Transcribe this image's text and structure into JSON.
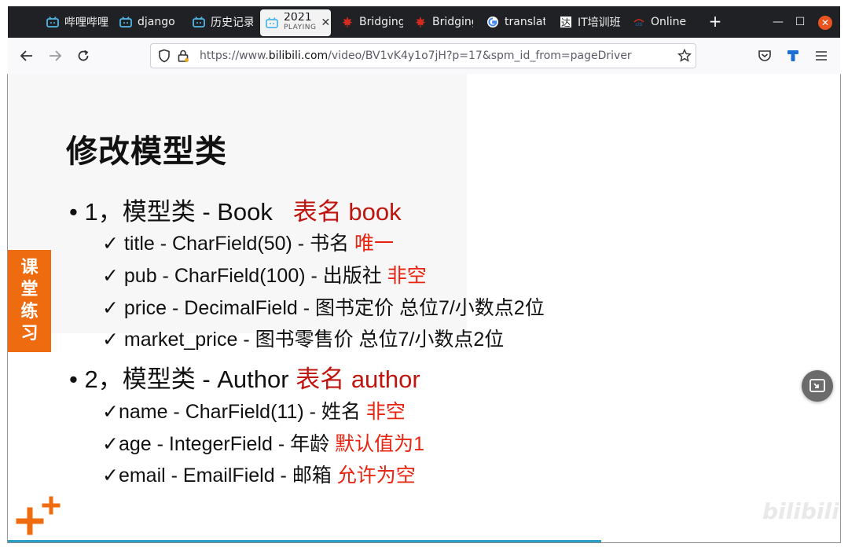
{
  "tabs": [
    {
      "label": "哔哩哔哩",
      "icon": "bilibili-icon"
    },
    {
      "label": "django",
      "icon": "bilibili-icon"
    },
    {
      "label": "历史记录",
      "icon": "bilibili-icon"
    },
    {
      "label": "2021",
      "sub": "PLAYING",
      "icon": "bilibili-icon",
      "active": true
    },
    {
      "label": "Bridging",
      "icon": "maple-leaf-icon"
    },
    {
      "label": "Bridging",
      "icon": "maple-leaf-icon"
    },
    {
      "label": "translat",
      "icon": "google-icon"
    },
    {
      "label": "IT培训班",
      "icon": "da-icon"
    },
    {
      "label": "Online",
      "icon": "citi-icon"
    }
  ],
  "url": {
    "prefix": "https://www.",
    "domain": "bilibili.com",
    "path": "/video/BV1vK4y1o7jH?p=17&spm_id_from=pageDriver"
  },
  "slide": {
    "title": "修改模型类",
    "side_tab": [
      "课",
      "堂",
      "练",
      "习"
    ],
    "item1": {
      "lead": "• 1，模型类 - Book",
      "red": "表名 book"
    },
    "item1_fields": [
      {
        "text": "✓  title - CharField(50)  - 书名 ",
        "red": "唯一"
      },
      {
        "text": "✓  pub - CharField(100)  - 出版社 ",
        "red": "非空"
      },
      {
        "text": "✓  price - DecimalField - 图书定价  总位7/小数点2位",
        "red": ""
      },
      {
        "text": "✓  market_price - 图书零售价  总位7/小数点2位",
        "red": ""
      }
    ],
    "item2": {
      "lead": "• 2，模型类 - Author ",
      "red": "表名 author"
    },
    "item2_fields": [
      {
        "text": "✓name - CharField(11)  - 姓名 ",
        "red": "非空"
      },
      {
        "text": "✓age - IntegerField - 年龄 ",
        "red": "默认值为1"
      },
      {
        "text": "✓email - EmailField - 邮箱 ",
        "red": "允许为空"
      }
    ],
    "watermark": "bilibili"
  },
  "colors": {
    "accent": "#ef6b10",
    "red": "#c0150f",
    "progress": "#2aa0c5"
  }
}
